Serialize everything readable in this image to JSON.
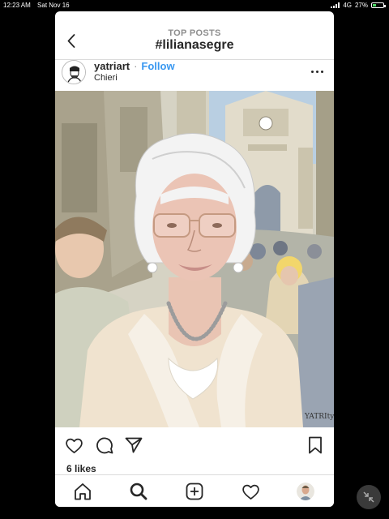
{
  "status_bar": {
    "time": "12:23 AM",
    "date": "Sat Nov 16",
    "network": "4G",
    "battery": "27%",
    "battery_level": 0.27
  },
  "header": {
    "subtitle": "TOP POSTS",
    "title": "#lilianasegre",
    "back_icon": "chevron-left-icon"
  },
  "post": {
    "username": "yatriart",
    "separator": "·",
    "follow_label": "Follow",
    "location": "Chieri",
    "more_icon": "ellipsis-icon",
    "likes": "6 likes",
    "signature": "YATRIty"
  },
  "actions": {
    "icons": [
      "heart-icon",
      "comment-icon",
      "share-icon",
      "bookmark-icon"
    ]
  },
  "tab_bar": {
    "icons": [
      "home-icon",
      "search-icon",
      "new-post-icon",
      "activity-heart-icon",
      "profile-avatar"
    ]
  },
  "colors": {
    "link_blue": "#3897f0",
    "text": "#262626",
    "muted": "#8e8e8e",
    "divider": "#dbdbdb"
  }
}
